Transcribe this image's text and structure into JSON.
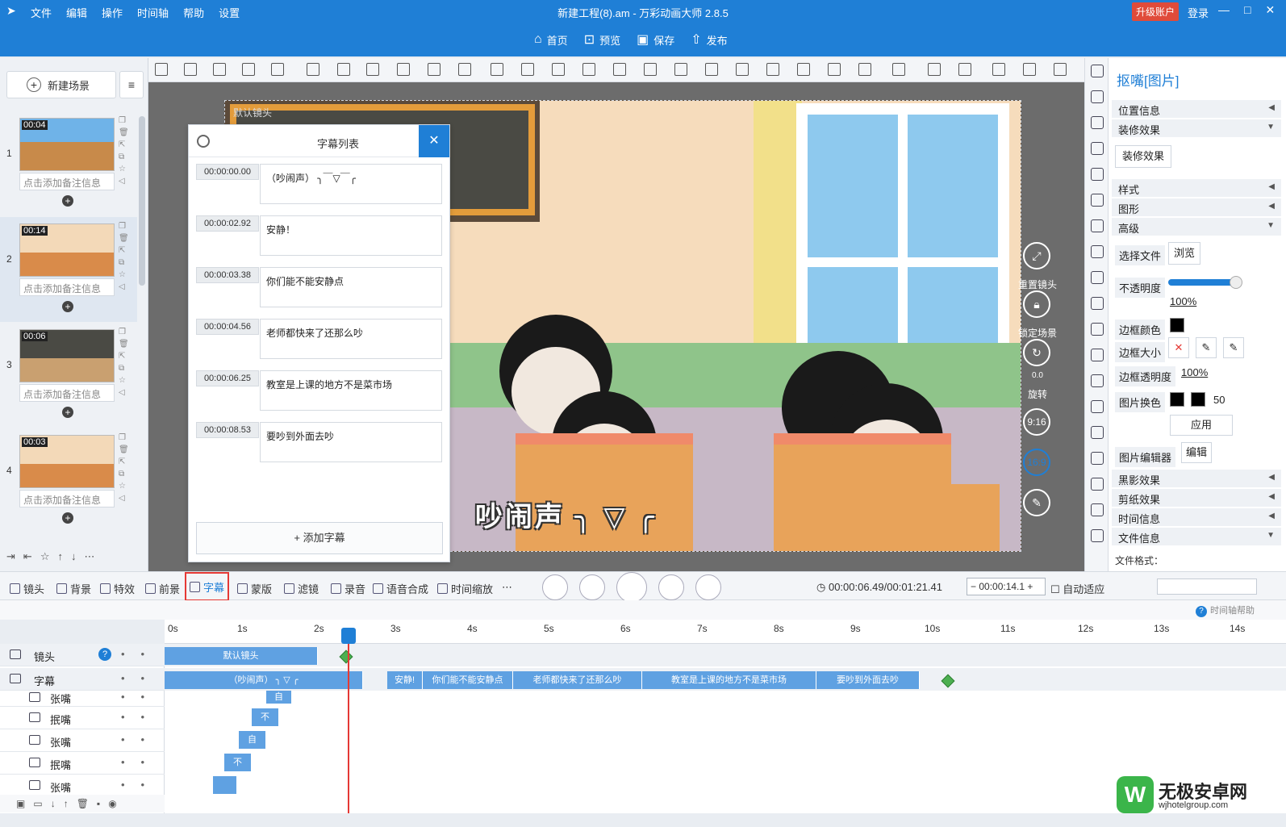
{
  "titlebar": {
    "menu": [
      "文件",
      "编辑",
      "操作",
      "时间轴",
      "帮助",
      "设置"
    ],
    "app_title": "新建工程(8).am - 万彩动画大师 2.8.5",
    "upgrade": "升级账户",
    "login": "登录"
  },
  "quickbar": {
    "home": "首页",
    "preview": "预览",
    "save": "保存",
    "publish": "发布"
  },
  "scenes": {
    "new_scene": "新建场景",
    "items": [
      {
        "num": "1",
        "duration": "00:04",
        "note": "点击添加备注信息"
      },
      {
        "num": "2",
        "duration": "00:14",
        "note": "点击添加备注信息"
      },
      {
        "num": "3",
        "duration": "00:06",
        "note": "点击添加备注信息"
      },
      {
        "num": "4",
        "duration": "00:03",
        "note": "点击添加备注信息"
      }
    ]
  },
  "canvas": {
    "camera_label": "默认镜头",
    "stage_subtitle": "吵闹声 ╮ ▽ ╭",
    "controls": {
      "reset_camera": "重置镜头",
      "lock_scene": "锁定场景",
      "rotate": "旋转",
      "rotate_value": "0.0",
      "ratio_916": "9:16",
      "ratio_169": "16:9"
    }
  },
  "subtitle_panel": {
    "title": "字幕列表",
    "add_button": "添加字幕",
    "rows": [
      {
        "time": "00:00:00.00",
        "text": "（吵闹声） ╮￣▽￣╭"
      },
      {
        "time": "00:00:02.92",
        "text": "安静！"
      },
      {
        "time": "00:00:03.38",
        "text": "你们能不能安静点"
      },
      {
        "time": "00:00:04.56",
        "text": "老师都快来了还那么吵"
      },
      {
        "time": "00:00:06.25",
        "text": "教室是上课的地方不是菜市场"
      },
      {
        "time": "00:00:08.53",
        "text": "要吵到外面去吵"
      }
    ]
  },
  "right_panel": {
    "title": "抠嘴[图片]",
    "sections": {
      "position": "位置信息",
      "decoration": "装修效果",
      "decoration_btn": "装修效果",
      "style": "样式",
      "shape": "图形",
      "advanced": "高级",
      "shadow": "黑影效果",
      "papercut": "剪纸效果",
      "time_info": "时间信息",
      "file_info": "文件信息",
      "file_format": "文件格式："
    },
    "select_file": "选择文件",
    "browse": "浏览",
    "opacity_label": "不透明度",
    "opacity_value": "100%",
    "border_color": "边框颜色",
    "border_size": "边框大小",
    "border_opacity": "边框透明度",
    "border_opacity_value": "100%",
    "image_swap": "图片换色",
    "image_swap_value": "50",
    "apply": "应用",
    "image_editor": "图片编辑器",
    "edit": "编辑"
  },
  "bottom_tabs": {
    "camera": "镜头",
    "background": "背景",
    "effects": "特效",
    "foreground": "前景",
    "subtitle": "字幕",
    "mask": "蒙版",
    "filter": "滤镜",
    "record": "录音",
    "tts": "语音合成",
    "timescale": "时间缩放",
    "timecode": "00:00:06.49/00:01:21.41",
    "time_box": "00:00:14.1",
    "auto_adapt": "自动适应"
  },
  "timeline": {
    "help": "时间轴帮助",
    "ruler": [
      "0s",
      "1s",
      "2s",
      "3s",
      "4s",
      "5s",
      "6s",
      "7s",
      "8s",
      "9s",
      "10s",
      "11s",
      "12s",
      "13s",
      "14s"
    ],
    "tracks": [
      {
        "name": "镜头"
      },
      {
        "name": "字幕"
      },
      {
        "name": "张嘴"
      },
      {
        "name": "抿嘴"
      },
      {
        "name": "张嘴"
      },
      {
        "name": "抿嘴"
      },
      {
        "name": "张嘴"
      }
    ],
    "camera_clip": "默认镜头",
    "subtitle_clips": [
      "（吵闹声） ╮ ▽ ╭",
      "安静!",
      "你们能不能安静点",
      "老师都快来了还那么吵",
      "教室是上课的地方不是菜市场",
      "要吵到外面去吵"
    ],
    "small_clips": [
      "自",
      "不",
      "自",
      "不"
    ]
  },
  "watermark": {
    "logo": "W",
    "title": "无极安卓网",
    "url": "wjhotelgroup.com"
  },
  "colors": {
    "accent": "#1f7fd6",
    "clip": "#5fa1e2",
    "highlight": "#e53935",
    "keyframe": "#4caf50"
  }
}
